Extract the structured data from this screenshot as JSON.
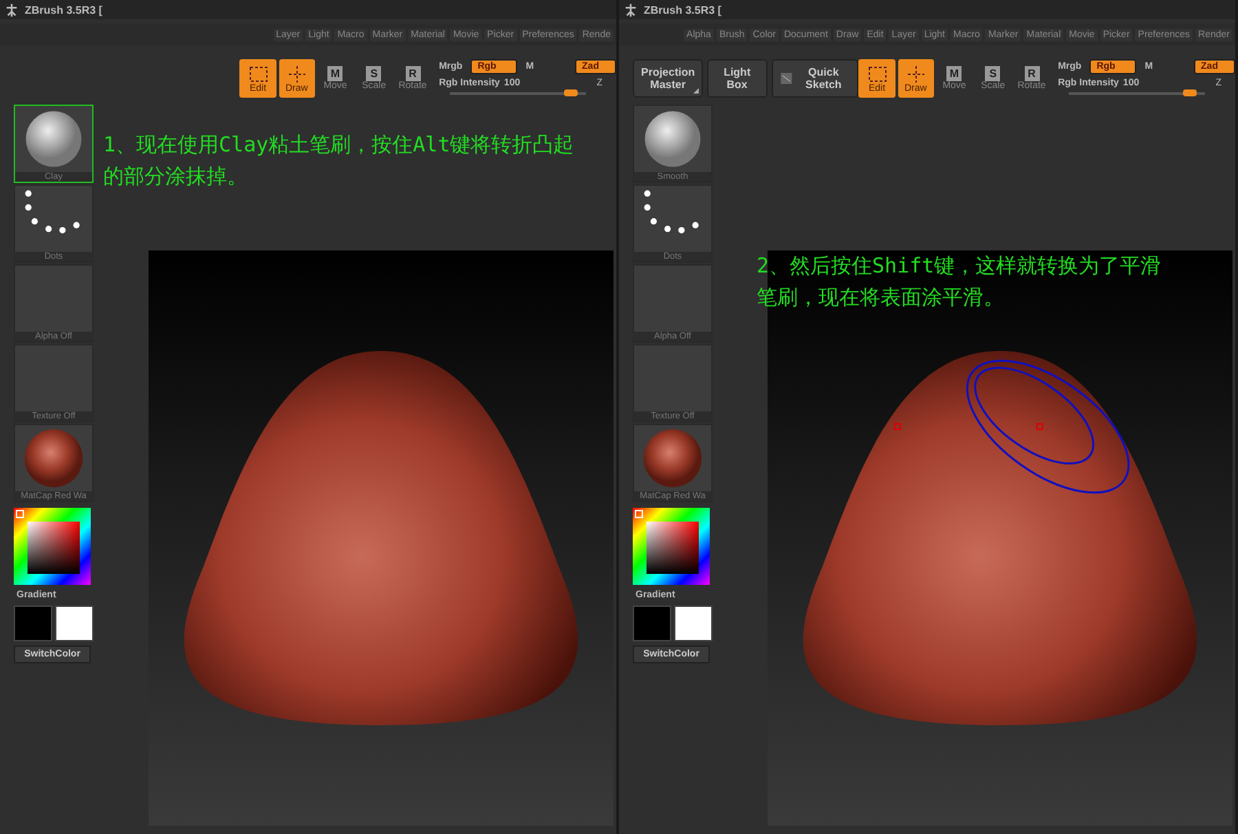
{
  "panels": [
    {
      "title": "ZBrush 3.5R3 [",
      "menu": [
        "Layer",
        "Light",
        "Macro",
        "Marker",
        "Material",
        "Movie",
        "Picker",
        "Preferences",
        "Rende"
      ],
      "transform": [
        {
          "label": "Edit",
          "kind": "edit",
          "selected": true
        },
        {
          "label": "Draw",
          "kind": "draw",
          "selected": true
        },
        {
          "label": "Move",
          "kind": "letter",
          "letter": "M",
          "selected": false
        },
        {
          "label": "Scale",
          "kind": "letter",
          "letter": "S",
          "selected": false
        },
        {
          "label": "Rotate",
          "kind": "letter",
          "letter": "R",
          "selected": false
        }
      ],
      "channels": {
        "mrgb": "Mrgb",
        "rgb": "Rgb",
        "m": "M",
        "zadd": "Zad",
        "z": "Z",
        "intensity_label": "Rgb Intensity",
        "intensity_value": "100",
        "level": 0.92
      },
      "tray": [
        {
          "kind": "brush",
          "label": "Clay",
          "highlighted": true
        },
        {
          "kind": "stroke",
          "label": "Dots",
          "highlighted": false
        },
        {
          "kind": "alpha",
          "label": "Alpha Off",
          "highlighted": false
        },
        {
          "kind": "texture",
          "label": "Texture Off",
          "highlighted": false
        },
        {
          "kind": "material",
          "label": "MatCap Red Wa",
          "highlighted": false
        }
      ],
      "gradient_label": "Gradient",
      "swatches": [
        {
          "color": "#000000"
        },
        {
          "color": "#ffffff"
        }
      ],
      "switch_label": "SwitchColor",
      "note": "1、现在使用Clay粘土笔刷，按住Alt键将转折凸起的部分涂抹掉。",
      "canvas": {
        "brush_cursor": false
      }
    },
    {
      "title": "ZBrush 3.5R3 [",
      "menu": [
        "Alpha",
        "Brush",
        "Color",
        "Document",
        "Draw",
        "Edit",
        "Layer",
        "Light",
        "Macro",
        "Marker",
        "Material",
        "Movie",
        "Picker",
        "Preferences",
        "Render"
      ],
      "left_buttons": [
        {
          "label": "Projection Master",
          "kind": "dropdown"
        },
        {
          "label": "Light Box",
          "kind": "plain"
        },
        {
          "label": "Quick Sketch",
          "kind": "sketch"
        }
      ],
      "transform": [
        {
          "label": "Edit",
          "kind": "edit",
          "selected": true
        },
        {
          "label": "Draw",
          "kind": "draw",
          "selected": true
        },
        {
          "label": "Move",
          "kind": "letter",
          "letter": "M",
          "selected": false
        },
        {
          "label": "Scale",
          "kind": "letter",
          "letter": "S",
          "selected": false
        },
        {
          "label": "Rotate",
          "kind": "letter",
          "letter": "R",
          "selected": false
        }
      ],
      "channels": {
        "mrgb": "Mrgb",
        "rgb": "Rgb",
        "m": "M",
        "zadd": "Zad",
        "z": "Z",
        "intensity_label": "Rgb Intensity",
        "intensity_value": "100",
        "level": 0.92
      },
      "tray": [
        {
          "kind": "brush",
          "label": "Smooth",
          "highlighted": false
        },
        {
          "kind": "stroke",
          "label": "Dots",
          "highlighted": false
        },
        {
          "kind": "alpha",
          "label": "Alpha Off",
          "highlighted": false
        },
        {
          "kind": "texture",
          "label": "Texture Off",
          "highlighted": false
        },
        {
          "kind": "material",
          "label": "MatCap Red Wa",
          "highlighted": false
        }
      ],
      "gradient_label": "Gradient",
      "swatches": [
        {
          "color": "#000000"
        },
        {
          "color": "#ffffff"
        }
      ],
      "switch_label": "SwitchColor",
      "canvas": {
        "note": "2、然后按住Shift键，这样就转换为了平滑笔刷，现在将表面涂平滑。",
        "brush_cursor": true
      }
    }
  ]
}
